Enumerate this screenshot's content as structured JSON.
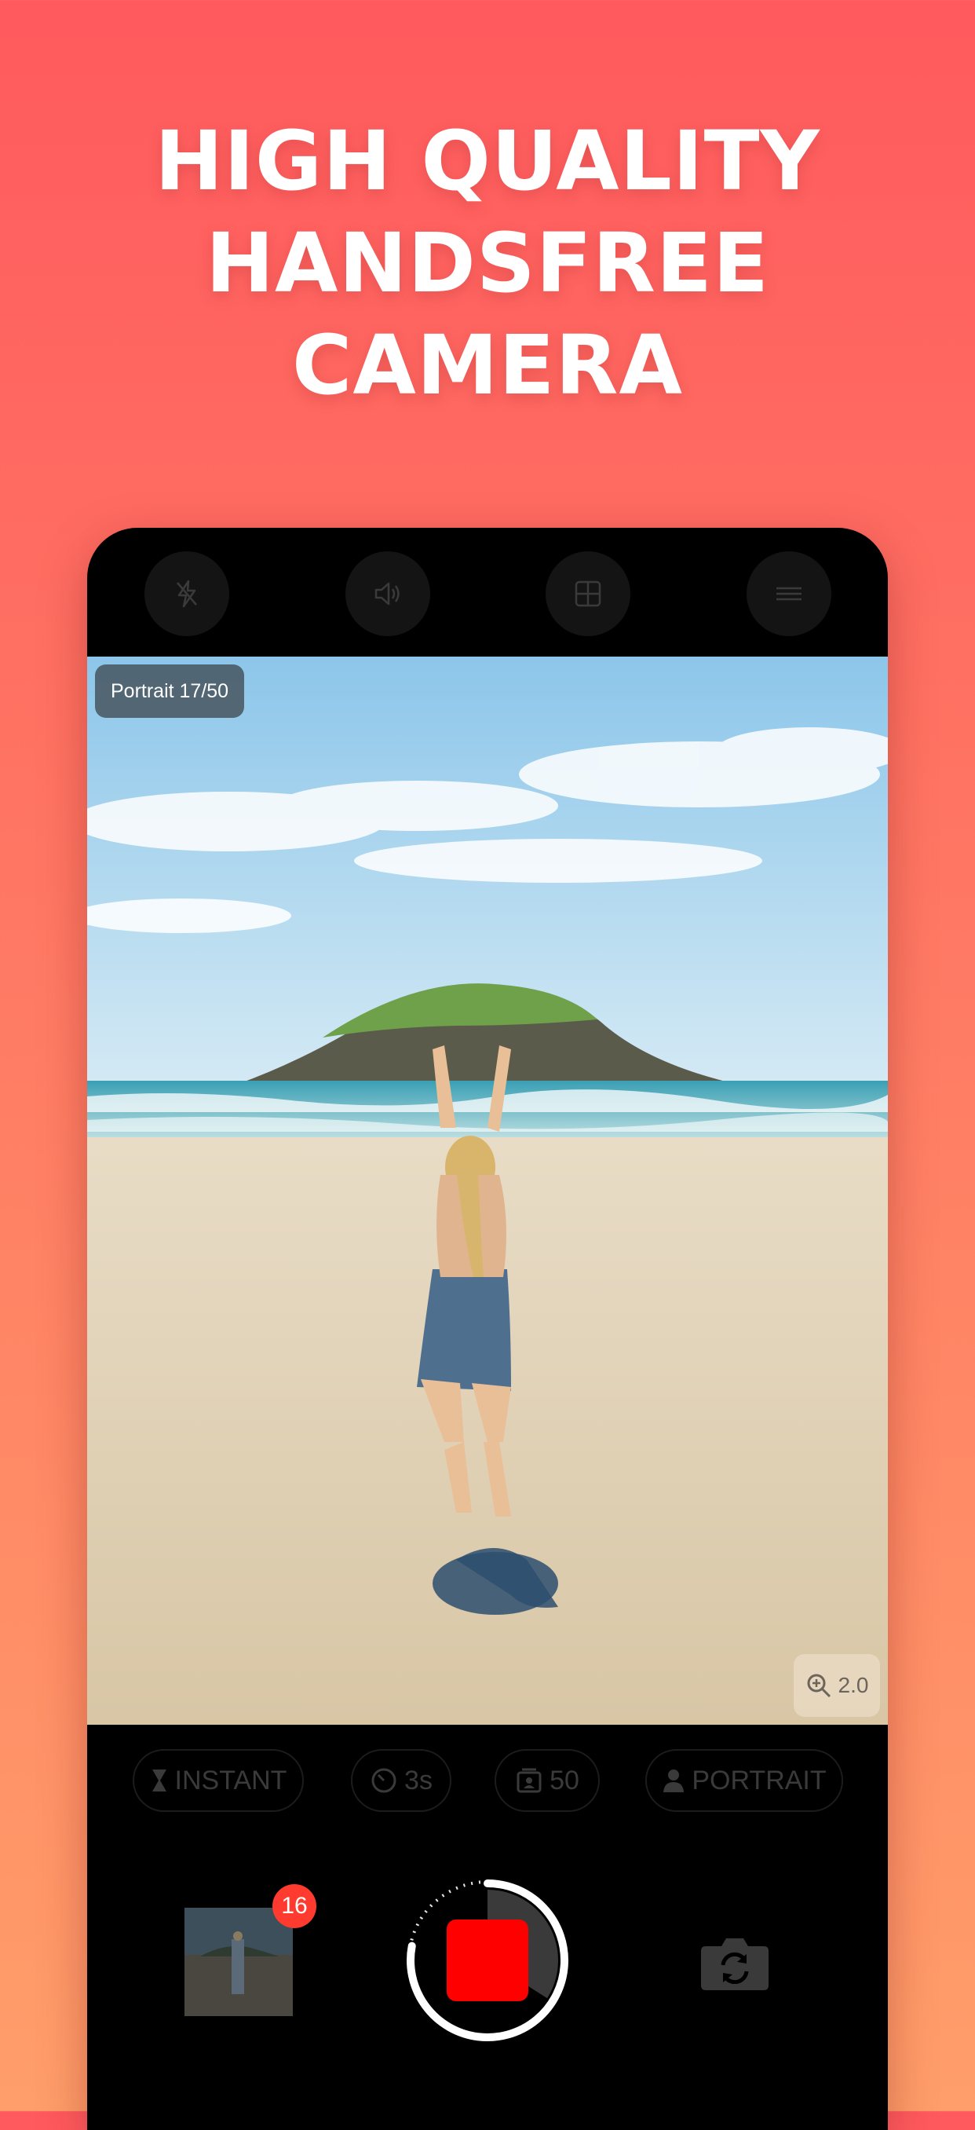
{
  "headline": {
    "line1": "HIGH QUALITY",
    "line2": "HANDSFREE",
    "line3": "CAMERA"
  },
  "topbar": {
    "buttons": [
      "flash-off-icon",
      "speaker-icon",
      "grid-icon",
      "menu-icon"
    ]
  },
  "viewfinder": {
    "mode_badge": "Portrait 17/50",
    "zoom_level": "2.0"
  },
  "options": {
    "instant_label": "INSTANT",
    "timer_label": "3s",
    "count_label": "50",
    "portrait_label": "PORTRAIT"
  },
  "bottom": {
    "gallery_count": "16",
    "shutter_progress": 0.34
  },
  "colors": {
    "background_top": "#ff5a5e",
    "background_bottom": "#ff9e6a",
    "record_red": "#ff0000",
    "badge_red": "#ff3b30"
  }
}
